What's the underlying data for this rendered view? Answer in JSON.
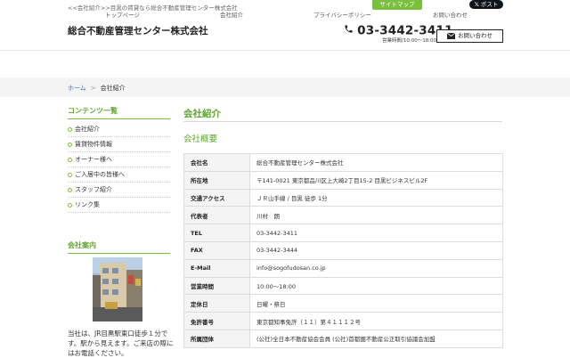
{
  "header": {
    "top_note": "<<会社紹介>>目黒の賃貸なら総合不動産管理センター株式会社",
    "sitemap_label": "サイトマップ",
    "xpost_label": "ポスト",
    "site_title": "総合不動産管理センター株式会社",
    "phone": "03-3442-3411",
    "hours": "営業時間/10:00〜18:00",
    "contact_label": "お問い合わせ"
  },
  "nav": {
    "items": [
      {
        "label": "トップページ"
      },
      {
        "label": "会社紹介"
      },
      {
        "label": "プライバシーポリシー"
      },
      {
        "label": "お問い合わせ"
      }
    ]
  },
  "breadcrumb": {
    "home": "ホーム",
    "separator": ">",
    "current": "会社紹介"
  },
  "sidebar": {
    "contents_heading": "コンテンツ一覧",
    "items": [
      {
        "label": "会社紹介"
      },
      {
        "label": "賃貸物件情報"
      },
      {
        "label": "オーナー様へ"
      },
      {
        "label": "ご入居中の皆様へ"
      },
      {
        "label": "スタッフ紹介"
      },
      {
        "label": "リンク集"
      }
    ],
    "company_heading": "会社案内",
    "company_text": "当社は、JR目黒駅東口徒歩１分です。駅から見えます。ご来店の際にはお電話ください。"
  },
  "main": {
    "page_title": "会社紹介",
    "section_title": "会社概要",
    "rows": [
      {
        "label": "会社名",
        "value": "総合不動産管理センター株式会社"
      },
      {
        "label": "所在地",
        "value": "〒141-0021 東京都品川区上大崎2丁目15-2 目黒ビジネスビル2F"
      },
      {
        "label": "交通アクセス",
        "value": "ＪＲ山手線 / 目黒 徒歩 1分"
      },
      {
        "label": "代表者",
        "value": "川村　朗"
      },
      {
        "label": "TEL",
        "value": "03-3442-3411"
      },
      {
        "label": "FAX",
        "value": "03-3442-3444"
      },
      {
        "label": "E-Mail",
        "value": "info@sogofudosan.co.jp"
      },
      {
        "label": "営業時間",
        "value": "10:00〜18:00"
      },
      {
        "label": "定休日",
        "value": "日曜・祭日"
      },
      {
        "label": "免許番号",
        "value": "東京都知事免許（１１）第４１１１２号"
      },
      {
        "label": "所属団体",
        "value": "(公社)全日本不動産協会会員 (公社)首都圏不動産公正取引協議会加盟"
      }
    ]
  },
  "colors": {
    "accent_green": "#5fa62e",
    "link_blue": "#3a77c4",
    "x_black": "#0f1419"
  },
  "icons": [
    "phone-icon",
    "mail-icon",
    "x-logo-icon",
    "bullet-icon"
  ]
}
